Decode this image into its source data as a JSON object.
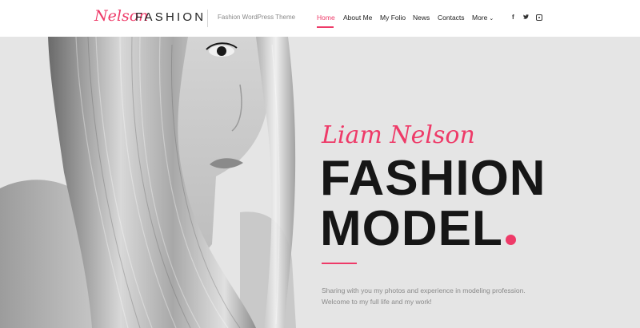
{
  "brand": {
    "script": "Nelson",
    "word": "FASHION",
    "tagline": "Fashion WordPress Theme"
  },
  "nav": {
    "items": [
      {
        "label": "Home",
        "active": true
      },
      {
        "label": "About Me"
      },
      {
        "label": "My Folio"
      },
      {
        "label": "News"
      },
      {
        "label": "Contacts"
      },
      {
        "label": "More"
      }
    ]
  },
  "social": {
    "icons": [
      "facebook-icon",
      "twitter-icon",
      "instagram-icon"
    ],
    "facebook_glyph": "f",
    "twitter_glyph": "•"
  },
  "hero": {
    "script_name": "Liam Nelson",
    "headline_line1": "FASHION",
    "headline_line2": "MODEL",
    "intro_line1": "Sharing with you my photos and experience in modeling profession.",
    "intro_line2": "Welcome to my full life and my work!"
  },
  "colors": {
    "accent": "#ee3a68",
    "text_dark": "#161616",
    "hero_bg": "#e5e5e5"
  }
}
